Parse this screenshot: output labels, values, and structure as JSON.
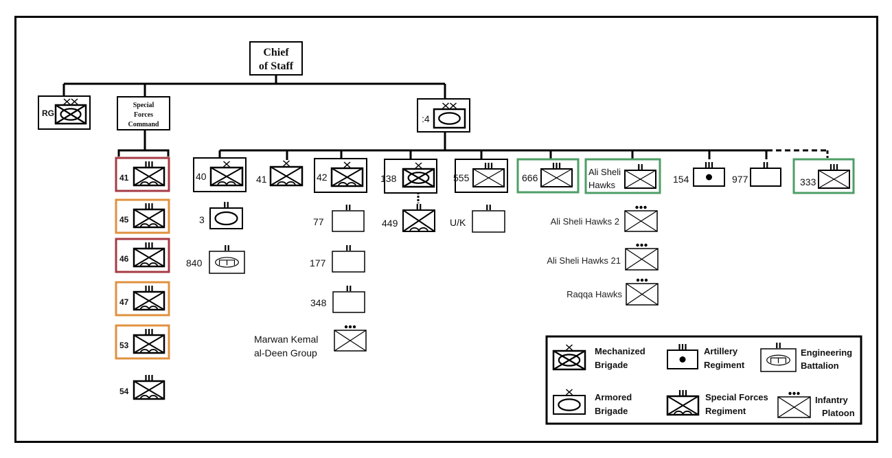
{
  "colors": {
    "line": "#000000",
    "red_frame": "#a63a44",
    "orange_frame": "#e0913f",
    "green_frame": "#4e9e66"
  },
  "hq": {
    "title_line1": "Chief",
    "title_line2": "of Staff"
  },
  "rg": {
    "label": "RG",
    "echelon": "XX",
    "type": "mechanized"
  },
  "sfc": {
    "title_line1": "Special",
    "title_line2": "Forces",
    "title_line3": "Command",
    "units": [
      {
        "label": "41",
        "echelon": "III",
        "type": "special-forces",
        "highlight": "red"
      },
      {
        "label": "45",
        "echelon": "III",
        "type": "special-forces",
        "highlight": "orange"
      },
      {
        "label": "46",
        "echelon": "III",
        "type": "special-forces",
        "highlight": "red"
      },
      {
        "label": "47",
        "echelon": "III",
        "type": "special-forces",
        "highlight": "orange"
      },
      {
        "label": "53",
        "echelon": "III",
        "type": "special-forces",
        "highlight": "orange"
      },
      {
        "label": "54",
        "echelon": "III",
        "type": "special-forces",
        "highlight": "none"
      }
    ]
  },
  "div4": {
    "label": ":4",
    "echelon": "XX",
    "type": "armored",
    "units": [
      {
        "label": "40",
        "echelon": "X",
        "type": "special-forces",
        "framed": true
      },
      {
        "label": "41",
        "echelon": "X",
        "type": "special-forces",
        "framed": false
      },
      {
        "label": "42",
        "echelon": "X",
        "type": "special-forces",
        "framed": true
      },
      {
        "label": "138",
        "echelon": "X",
        "type": "mechanized",
        "framed": true
      },
      {
        "label": "555",
        "echelon": "III",
        "type": "infantry",
        "framed": true
      },
      {
        "label": "666",
        "echelon": "III",
        "type": "infantry",
        "highlight": "green"
      },
      {
        "label_line1": "Ali Sheli",
        "label_line2": "Hawks",
        "echelon": "II",
        "type": "infantry",
        "highlight": "green"
      },
      {
        "label": "154",
        "echelon": "III",
        "type": "artillery"
      },
      {
        "label": "977",
        "echelon": "II",
        "type": "empty"
      },
      {
        "label": "333",
        "echelon": "III",
        "type": "infantry",
        "highlight": "green",
        "link": "dashed"
      }
    ],
    "sub_40": [
      {
        "label": "3",
        "echelon": "II",
        "type": "armored"
      },
      {
        "label": "840",
        "echelon": "II",
        "type": "engineering"
      }
    ],
    "sub_42": [
      {
        "label": "77",
        "echelon": "II",
        "type": "empty"
      },
      {
        "label": "177",
        "echelon": "II",
        "type": "empty"
      },
      {
        "label": "348",
        "echelon": "II",
        "type": "empty"
      },
      {
        "label_line1": "Marwan Kemal",
        "label_line2": "al-Deen Group",
        "echelon": "•••",
        "type": "infantry"
      }
    ],
    "sub_138": [
      {
        "label": "449",
        "echelon": "II",
        "type": "special-forces",
        "link": "dotted"
      }
    ],
    "sub_555": [
      {
        "label": "U/K",
        "echelon": "II",
        "type": "empty"
      }
    ],
    "sub_hawks": [
      {
        "label": "Ali Sheli Hawks 2",
        "echelon": "•••",
        "type": "infantry"
      },
      {
        "label": "Ali Sheli Hawks 21",
        "echelon": "•••",
        "type": "infantry"
      },
      {
        "label": "Raqqa Hawks",
        "echelon": "•••",
        "type": "infantry"
      }
    ]
  },
  "legend": {
    "items": [
      {
        "line1": "Mechanized",
        "line2": "Brigade",
        "symbol": "mechanized",
        "echelon": "X"
      },
      {
        "line1": "Artillery",
        "line2": "Regiment",
        "symbol": "artillery",
        "echelon": "III"
      },
      {
        "line1": "Engineering",
        "line2": "Battalion",
        "symbol": "engineering",
        "echelon": "II"
      },
      {
        "line1": "Armored",
        "line2": "Brigade",
        "symbol": "armored",
        "echelon": "X"
      },
      {
        "line1": "Special Forces",
        "line2": "Regiment",
        "symbol": "special-forces",
        "echelon": "III"
      },
      {
        "line1": "Infantry",
        "line2": "Platoon",
        "symbol": "infantry",
        "echelon": "•••"
      }
    ]
  }
}
